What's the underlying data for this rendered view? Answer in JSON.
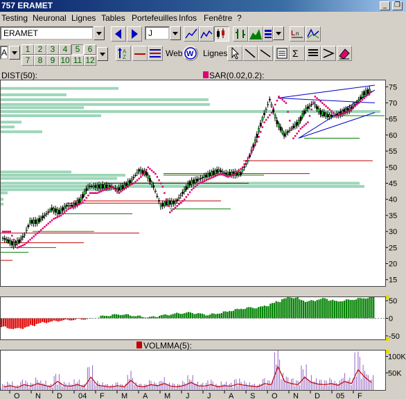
{
  "window": {
    "title": "757 ERAMET",
    "minimize": "_"
  },
  "menu": [
    "Testing",
    "Neuronal",
    "Lignes",
    "Tables",
    "Portefeuilles",
    "Infos",
    "Fenêtre",
    "?"
  ],
  "toolbar1": {
    "symbol": "ERAMET",
    "period": "J"
  },
  "toolbar2": {
    "mode_label": "A",
    "numbers_top": [
      "2",
      "3",
      "4",
      "5",
      "6"
    ],
    "numbers_bottom": [
      "8",
      "9",
      "10",
      "11",
      "12"
    ],
    "first_top": "1",
    "first_bottom": "7",
    "web_label": "Web",
    "lignes_label": "Lignes",
    "web_icon_letter": "W"
  },
  "indicators": {
    "dist": "DIST(50):",
    "sar": "SAR(0.02,0.2):",
    "volmma": "VOLMMA(5):"
  },
  "colors": {
    "bg": "#d4d0c8",
    "price_up": "#20c020",
    "price_down": "#000000",
    "sar": "#e00070",
    "dist_bars": "#9cd6b8",
    "support": "#008000",
    "resistance": "#c00000",
    "oscillator_pos": "#008000",
    "oscillator_neg": "#e00000",
    "volume": "#9060c0",
    "volume_mma": "#c00000"
  },
  "chart_data": [
    {
      "type": "candlestick",
      "title": "",
      "y_ticks": [
        "75",
        "70",
        "65",
        "60",
        "55",
        "50",
        "45",
        "40",
        "35",
        "30",
        "25",
        "20",
        "15"
      ],
      "ylim": [
        13,
        77
      ],
      "x_ticks": [
        "O",
        "N",
        "D",
        "04",
        "F",
        "M",
        "A",
        "M",
        "J",
        "J",
        "A",
        "S",
        "O",
        "N",
        "D",
        "05",
        "F"
      ],
      "close_points": [
        [
          0,
          28
        ],
        [
          6,
          27
        ],
        [
          12,
          26
        ],
        [
          18,
          27
        ],
        [
          24,
          29
        ],
        [
          30,
          33
        ],
        [
          38,
          33
        ],
        [
          46,
          35
        ],
        [
          54,
          37
        ],
        [
          62,
          36
        ],
        [
          70,
          38
        ],
        [
          78,
          38
        ],
        [
          86,
          40
        ],
        [
          94,
          44
        ],
        [
          102,
          44
        ],
        [
          110,
          44
        ],
        [
          118,
          44
        ],
        [
          126,
          43
        ],
        [
          134,
          44
        ],
        [
          142,
          46
        ],
        [
          150,
          49
        ],
        [
          158,
          48
        ],
        [
          166,
          44
        ],
        [
          174,
          38
        ],
        [
          182,
          39
        ],
        [
          190,
          39
        ],
        [
          198,
          42
        ],
        [
          206,
          45
        ],
        [
          214,
          46
        ],
        [
          222,
          47
        ],
        [
          230,
          48
        ],
        [
          238,
          49
        ],
        [
          246,
          48
        ],
        [
          254,
          48
        ],
        [
          262,
          48
        ],
        [
          270,
          52
        ],
        [
          278,
          58
        ],
        [
          286,
          65
        ],
        [
          294,
          71
        ],
        [
          302,
          64
        ],
        [
          310,
          60
        ],
        [
          318,
          62
        ],
        [
          326,
          64
        ],
        [
          334,
          68
        ],
        [
          342,
          70
        ],
        [
          350,
          67
        ],
        [
          358,
          66
        ],
        [
          366,
          66
        ],
        [
          374,
          67
        ],
        [
          382,
          68
        ],
        [
          390,
          70
        ],
        [
          398,
          73
        ],
        [
          406,
          74
        ]
      ],
      "sar_points": [
        [
          0,
          30
        ],
        [
          8,
          30
        ],
        [
          16,
          25
        ],
        [
          24,
          26
        ],
        [
          32,
          28
        ],
        [
          40,
          30
        ],
        [
          48,
          32
        ],
        [
          56,
          34
        ],
        [
          64,
          35
        ],
        [
          72,
          37
        ],
        [
          80,
          38
        ],
        [
          88,
          39
        ],
        [
          96,
          42
        ],
        [
          104,
          42
        ],
        [
          112,
          43
        ],
        [
          120,
          44
        ],
        [
          128,
          42
        ],
        [
          136,
          44
        ],
        [
          144,
          45
        ],
        [
          152,
          47
        ],
        [
          160,
          50
        ],
        [
          168,
          48
        ],
        [
          176,
          44
        ],
        [
          184,
          36
        ],
        [
          192,
          38
        ],
        [
          200,
          40
        ],
        [
          208,
          43
        ],
        [
          216,
          45
        ],
        [
          224,
          46
        ],
        [
          232,
          47
        ],
        [
          240,
          48
        ],
        [
          248,
          47
        ],
        [
          256,
          48
        ],
        [
          264,
          50
        ],
        [
          272,
          54
        ],
        [
          280,
          58
        ],
        [
          288,
          64
        ],
        [
          296,
          67
        ],
        [
          304,
          72
        ],
        [
          312,
          70
        ],
        [
          320,
          59
        ],
        [
          328,
          62
        ],
        [
          336,
          64
        ],
        [
          344,
          72
        ],
        [
          352,
          70
        ],
        [
          360,
          68
        ],
        [
          368,
          66
        ],
        [
          376,
          67
        ],
        [
          384,
          68
        ],
        [
          392,
          70
        ],
        [
          400,
          72
        ],
        [
          408,
          74
        ]
      ],
      "dist_bars": [
        {
          "price": 74.5,
          "length": 170
        },
        {
          "price": 72.5,
          "length": 95
        },
        {
          "price": 71,
          "length": 300
        },
        {
          "price": 69.5,
          "length": 302
        },
        {
          "price": 68.5,
          "length": 120
        },
        {
          "price": 67.3,
          "length": 548
        },
        {
          "price": 66,
          "length": 145
        },
        {
          "price": 64,
          "length": 30
        },
        {
          "price": 62.5,
          "length": 20
        },
        {
          "price": 61,
          "length": 60
        },
        {
          "price": 48.5,
          "length": 102
        },
        {
          "price": 47.5,
          "length": 180
        },
        {
          "price": 46.5,
          "length": 168
        },
        {
          "price": 45,
          "length": 518
        },
        {
          "price": 44,
          "length": 525
        },
        {
          "price": 43,
          "length": 160
        },
        {
          "price": 42,
          "length": 10
        },
        {
          "price": 40,
          "length": 4
        },
        {
          "price": 38.5,
          "length": 4
        }
      ],
      "support_lines": [
        {
          "y": 66,
          "x_start": 462,
          "x_end": 554
        },
        {
          "y": 59,
          "x_start": 438,
          "x_end": 518
        },
        {
          "y": 47.5,
          "x_start": 235,
          "x_end": 380
        },
        {
          "y": 37,
          "x_start": 244,
          "x_end": 332
        },
        {
          "y": 35.5,
          "x_start": 82,
          "x_end": 190
        },
        {
          "y": 30,
          "x_start": 46,
          "x_end": 135
        },
        {
          "y": 25,
          "x_start": 0,
          "x_end": 80
        },
        {
          "y": 23.5,
          "x_start": 0,
          "x_end": 40
        }
      ],
      "resistance_lines": [
        {
          "y": 52,
          "x_start": 350,
          "x_end": 537
        },
        {
          "y": 48,
          "x_start": 235,
          "x_end": 446
        },
        {
          "y": 45,
          "x_start": 150,
          "x_end": 358
        },
        {
          "y": 39.5,
          "x_start": 105,
          "x_end": 318
        },
        {
          "y": 38.8,
          "x_start": 95,
          "x_end": 262
        },
        {
          "y": 29.5,
          "x_start": 0,
          "x_end": 200
        },
        {
          "y": 26.5,
          "x_start": 0,
          "x_end": 120
        },
        {
          "y": 21,
          "x_start": 0,
          "x_end": 17
        }
      ]
    },
    {
      "type": "bar",
      "title": "",
      "y_ticks": [
        "50",
        "0",
        "-50"
      ],
      "ylim": [
        -60,
        60
      ],
      "series": [
        {
          "values": [
            -25,
            -28,
            -30,
            -28,
            -25,
            -20,
            -15,
            -12,
            -10,
            -8,
            -6,
            -5,
            -4,
            -3,
            -2,
            -1,
            2,
            6,
            8,
            10,
            11,
            10,
            8,
            6,
            4,
            3,
            5,
            8,
            10,
            12,
            14,
            15,
            16,
            14,
            12,
            10,
            12,
            15,
            18,
            22,
            25,
            28,
            30,
            30,
            32,
            36,
            42,
            48,
            55,
            60,
            58,
            52,
            48,
            50,
            54,
            56,
            52,
            48,
            50,
            52,
            54,
            56,
            58,
            60
          ]
        }
      ]
    },
    {
      "type": "bar",
      "title": "",
      "y_ticks": [
        "100K",
        "50K"
      ],
      "ylim": [
        0,
        120000
      ],
      "series": [
        {
          "name": "VOLMMA(5)",
          "values": [
            15000,
            20000,
            12000,
            25000,
            18000,
            30000,
            22000,
            15000,
            40000,
            20000,
            18000,
            25000,
            15000,
            60000,
            22000,
            18000,
            14000,
            20000,
            15000,
            45000,
            18000,
            15000,
            25000,
            20000,
            30000,
            18000,
            15000,
            22000,
            35000,
            20000,
            18000,
            25000,
            15000,
            20000,
            18000,
            28000,
            22000,
            18000,
            15000,
            30000,
            25000,
            110000,
            40000,
            30000,
            25000,
            60000,
            35000,
            28000,
            25000,
            30000,
            22000,
            40000,
            30000,
            95000,
            60000,
            35000
          ]
        }
      ]
    }
  ]
}
